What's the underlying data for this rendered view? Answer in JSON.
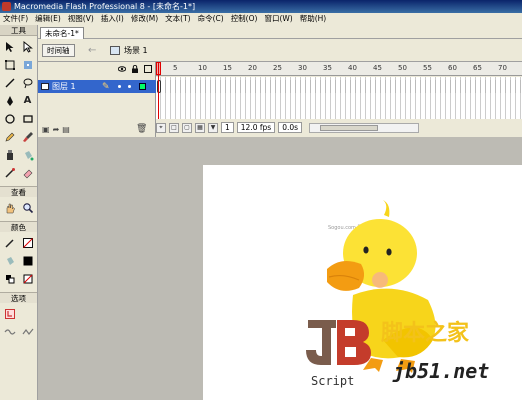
{
  "window": {
    "title": "Macromedia Flash Professional 8 - [未命名-1*]"
  },
  "menu": [
    "文件(F)",
    "编辑(E)",
    "视图(V)",
    "插入(I)",
    "修改(M)",
    "文本(T)",
    "命令(C)",
    "控制(O)",
    "窗口(W)",
    "帮助(H)"
  ],
  "toolbox": {
    "header": "工具",
    "view_label": "查看",
    "colors_label": "颜色",
    "options_label": "选项"
  },
  "document": {
    "tab": "未命名-1*"
  },
  "scene": {
    "timeline_button": "时间轴",
    "scene_label": "场景 1"
  },
  "timeline": {
    "layer_name": "图层 1",
    "ruler_ticks": [
      "5",
      "10",
      "15",
      "20",
      "25",
      "30",
      "35",
      "40",
      "45",
      "50",
      "55",
      "60",
      "65",
      "70"
    ],
    "current_frame": "1",
    "fps": "12.0 fps",
    "elapsed": "0.0s"
  },
  "watermark": {
    "brand_text": "脚本之家",
    "site_text": "jb51.net",
    "logo_caption": "Script",
    "small_text": "Sogou.com 图库"
  },
  "colors": {
    "layer_highlight": "#3366cc",
    "playhead": "#e00000",
    "stage": "#ffffff",
    "workspace": "#bdbbb4"
  }
}
